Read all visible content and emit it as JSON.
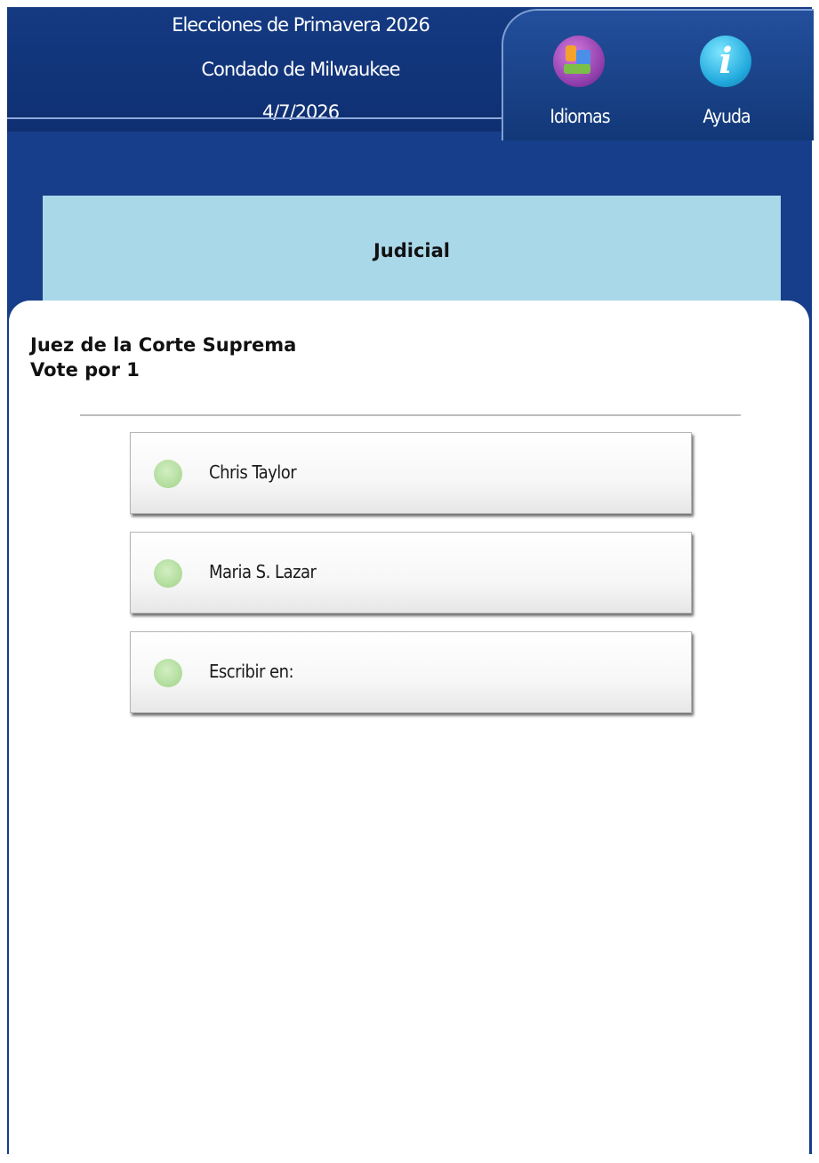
{
  "header": {
    "election_title": "Elecciones de Primavera 2026",
    "county": "Condado de Milwaukee",
    "date": "4/7/2026"
  },
  "toolbar": {
    "languages_label": "Idiomas",
    "help_label": "Ayuda",
    "languages_icon": "languages-icon",
    "help_icon": "info-icon",
    "help_glyph": "i"
  },
  "category": {
    "title": "Judicial"
  },
  "contest": {
    "title": "Juez de la Corte Suprema",
    "instruction": "Vote por 1",
    "choices": [
      {
        "label": "Chris Taylor",
        "selected": false
      },
      {
        "label": "Maria S. Lazar",
        "selected": false
      },
      {
        "label": "Escribir en:",
        "selected": false
      }
    ]
  },
  "colors": {
    "frame_blue": "#173e8a",
    "category_band": "#a9d8e9",
    "radio_green": "#b4dea0"
  }
}
